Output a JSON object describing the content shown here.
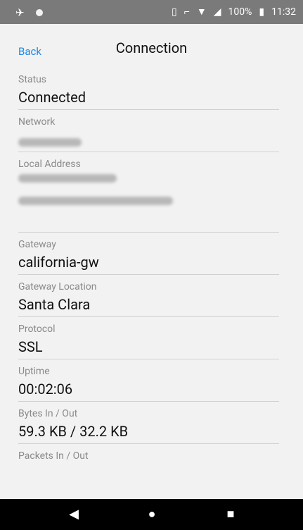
{
  "status_bar": {
    "battery": "100%",
    "time": "11:32"
  },
  "header": {
    "back_label": "Back",
    "title": "Connection"
  },
  "fields": [
    {
      "label": "Status",
      "value": "Connected"
    },
    {
      "label": "Network",
      "value": ""
    },
    {
      "label": "Local Address",
      "value": ""
    },
    {
      "label": "Gateway",
      "value": "california-gw"
    },
    {
      "label": "Gateway Location",
      "value": "Santa Clara"
    },
    {
      "label": "Protocol",
      "value": "SSL"
    },
    {
      "label": "Uptime",
      "value": "00:02:06"
    },
    {
      "label": "Bytes In / Out",
      "value": "59.3 KB / 32.2 KB"
    },
    {
      "label": "Packets In / Out",
      "value": ""
    }
  ],
  "nav": {
    "back_icon": "back-triangle-icon",
    "home_icon": "home-circle-icon",
    "recents_icon": "recents-square-icon"
  }
}
